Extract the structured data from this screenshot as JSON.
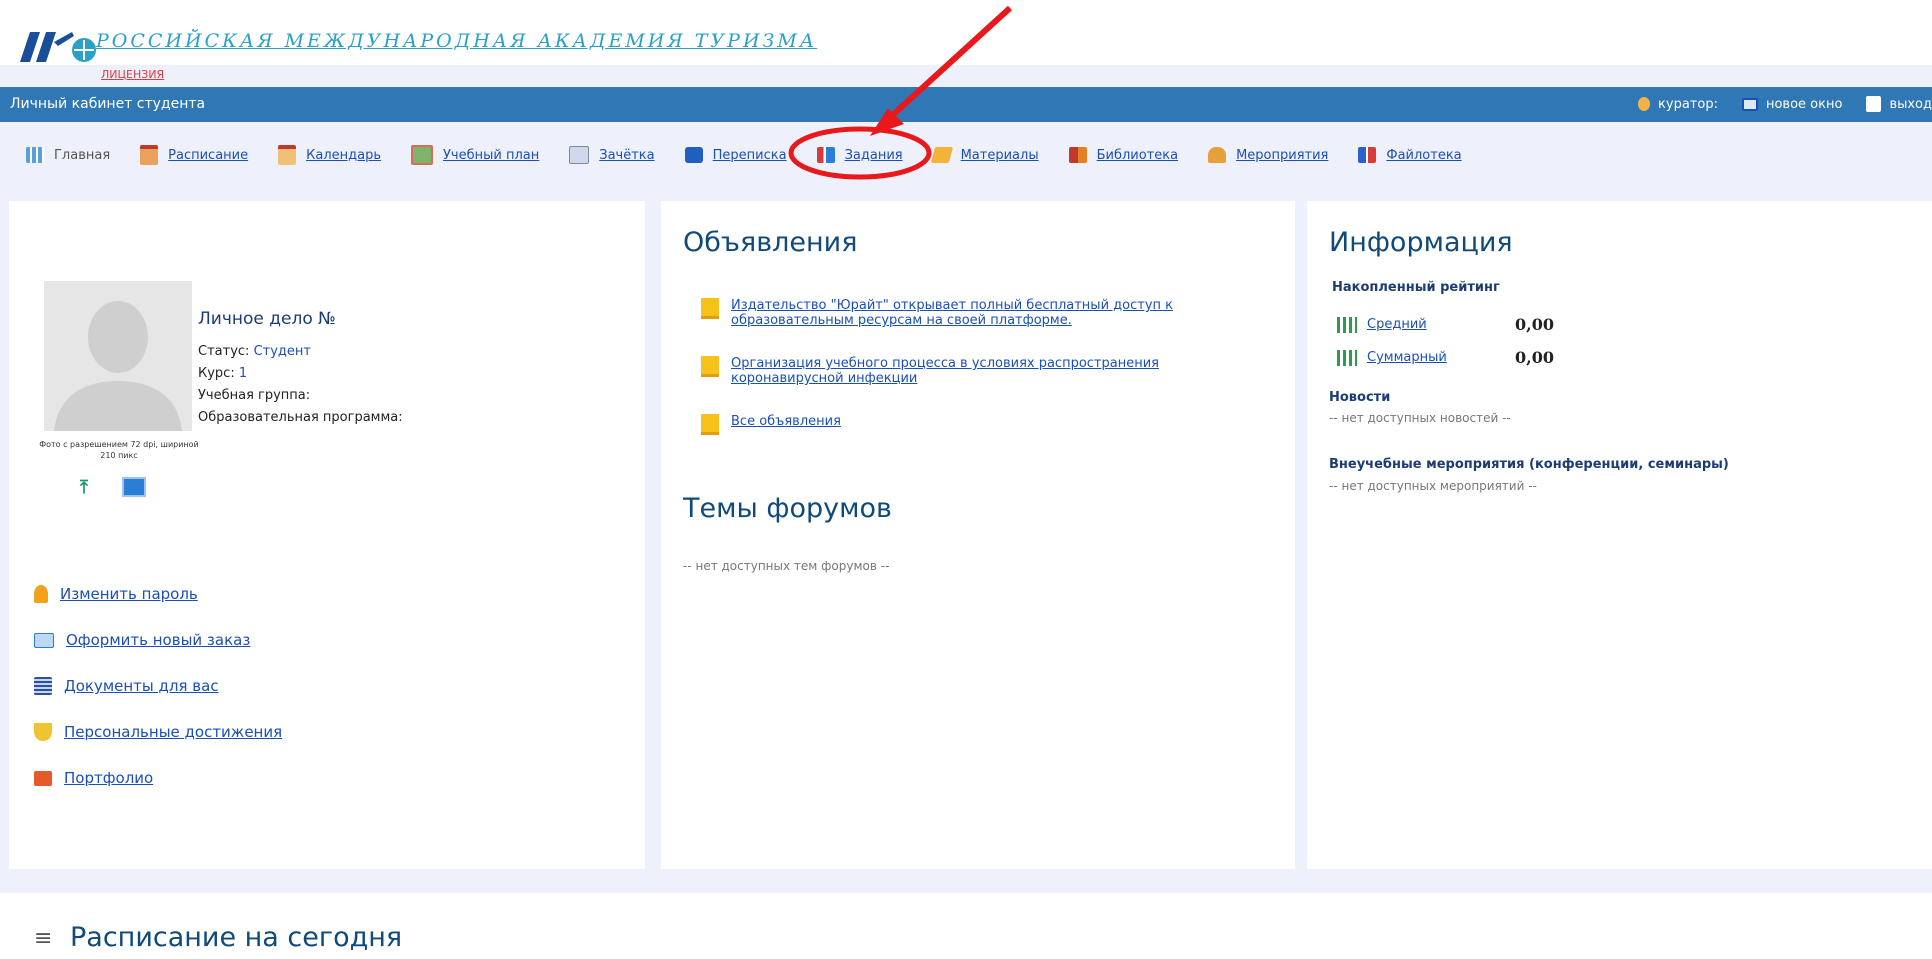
{
  "brand": {
    "title": "РОССИЙСКАЯ МЕЖДУНАРОДНАЯ АКАДЕМИЯ ТУРИЗМА",
    "license": "лицензия"
  },
  "topbar": {
    "cabinet": "Личный кабинет студента",
    "curator": "куратор:",
    "new_window": "новое окно",
    "exit": "выход"
  },
  "nav": [
    {
      "label": "Главная",
      "icon": "grid-icon"
    },
    {
      "label": "Расписание",
      "icon": "calendar-icon"
    },
    {
      "label": "Календарь",
      "icon": "calendar-icon"
    },
    {
      "label": "Учебный план",
      "icon": "plan-icon"
    },
    {
      "label": "Зачётка",
      "icon": "record-book-icon"
    },
    {
      "label": "Переписка",
      "icon": "chat-icon"
    },
    {
      "label": "Задания",
      "icon": "tasks-icon"
    },
    {
      "label": "Материалы",
      "icon": "materials-icon"
    },
    {
      "label": "Библиотека",
      "icon": "books-icon"
    },
    {
      "label": "Мероприятия",
      "icon": "people-icon"
    },
    {
      "label": "Файлотека",
      "icon": "files-icon"
    }
  ],
  "profile": {
    "case_title": "Личное дело №",
    "status_label": "Статус:",
    "status_value": "Студент",
    "course_label": "Курс:",
    "course_value": "1",
    "group_label": "Учебная группа:",
    "program_label": "Образовательная программа:",
    "photo_note": "Фото с разрешением 72 dpi, шириной 210 пикс"
  },
  "links": [
    {
      "label": "Изменить пароль",
      "icon": "key-icon"
    },
    {
      "label": "Оформить новый заказ",
      "icon": "card-icon"
    },
    {
      "label": "Документы для вас",
      "icon": "document-icon"
    },
    {
      "label": "Персональные достижения",
      "icon": "trophy-icon"
    },
    {
      "label": "Портфолио",
      "icon": "briefcase-icon"
    }
  ],
  "announcements": {
    "title": "Объявления",
    "items": [
      "Издательство \"Юрайт\" открывает полный бесплатный доступ к образовательным ресурсам на своей платформе.",
      "Организация учебного процесса в условиях распространения коронавирусной инфекции",
      "Все объявления"
    ]
  },
  "forums": {
    "title": "Темы форумов",
    "empty": "-- нет доступных тем форумов --"
  },
  "info": {
    "title": "Информация",
    "rating_header": "Накопленный рейтинг",
    "avg_label": "Средний",
    "avg_value": "0,00",
    "sum_label": "Суммарный",
    "sum_value": "0,00",
    "news_header": "Новости",
    "news_empty": "-- нет доступных новостей --",
    "events_header": "Внеучебные мероприятия (конференции, семинары)",
    "events_empty": "-- нет доступных мероприятий --"
  },
  "schedule": {
    "title": "Расписание на сегодня"
  },
  "colors": {
    "topbar": "#2f78b5",
    "link": "#1a4fb8",
    "annotation": "#e8181b"
  }
}
